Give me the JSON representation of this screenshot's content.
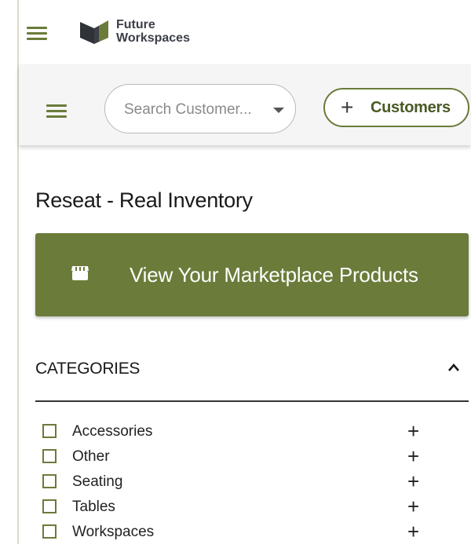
{
  "brand": {
    "line1": "Future",
    "line2": "Workspaces",
    "color": "#3b3f47"
  },
  "theme": {
    "accent": "#6b7b3a",
    "toolbar_bg": "#f5f5f5"
  },
  "icons": {
    "nav_menu": "hamburger-icon",
    "logo": "future-workspaces-logo",
    "toolbar_menu": "hamburger-icon",
    "search_dropdown": "caret-down-icon",
    "add_customer": "plus-icon",
    "marketplace": "store-icon",
    "categories_toggle": "chevron-up-icon",
    "category_expand": "plus-icon"
  },
  "search": {
    "placeholder": "Search Customer...",
    "value": ""
  },
  "customers_button": {
    "plus": "+",
    "label": "Customers"
  },
  "page": {
    "title": "Reseat - Real Inventory"
  },
  "marketplace_button": {
    "label": "View Your Marketplace Products"
  },
  "categories": {
    "heading": "CATEGORIES",
    "expanded": true,
    "items": [
      {
        "label": "Accessories",
        "checked": false,
        "expand": "+"
      },
      {
        "label": "Other",
        "checked": false,
        "expand": "+"
      },
      {
        "label": "Seating",
        "checked": false,
        "expand": "+"
      },
      {
        "label": "Tables",
        "checked": false,
        "expand": "+"
      },
      {
        "label": "Workspaces",
        "checked": false,
        "expand": "+"
      }
    ]
  }
}
